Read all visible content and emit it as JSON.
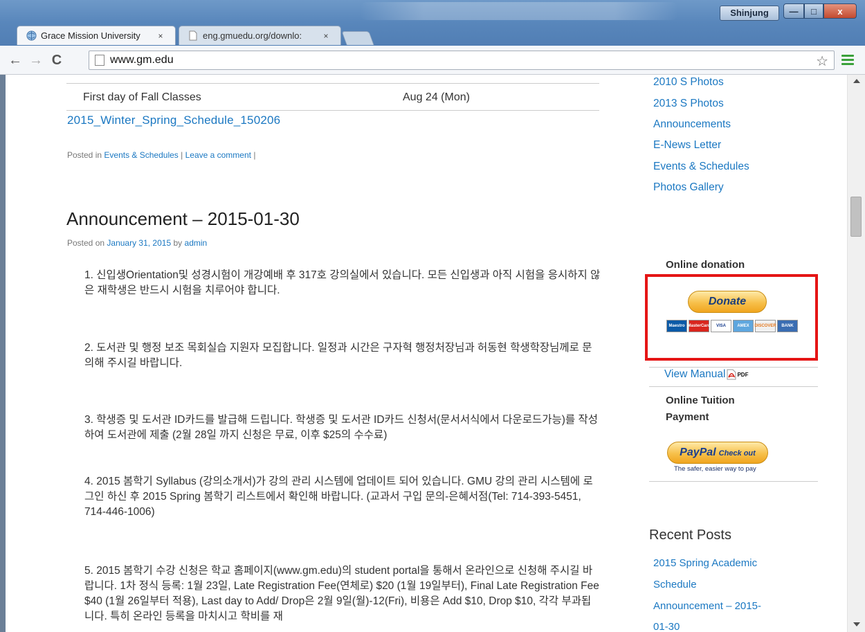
{
  "window": {
    "user": "Shinjung",
    "min_glyph": "—",
    "max_glyph": "□",
    "close_glyph": "x"
  },
  "tabs": [
    {
      "title": "Grace Mission University",
      "close": "×",
      "active": true
    },
    {
      "title": "eng.gmuedu.org/downlo:",
      "close": "×",
      "active": false
    }
  ],
  "toolbar": {
    "back": "←",
    "forward": "→",
    "reload": "C",
    "url": "www.gm.edu",
    "star": "☆"
  },
  "schedule": {
    "event": "First day of Fall Classes",
    "date": "Aug 24 (Mon)",
    "file_link": "2015_Winter_Spring_Schedule_150206"
  },
  "prev_post": {
    "posted_in": "Posted in",
    "category": "Events & Schedules",
    "sep1": " | ",
    "comment": "Leave a comment",
    "sep2": " |"
  },
  "post": {
    "title": "Announcement – 2015-01-30",
    "posted_on": "Posted on",
    "date": "January 31, 2015",
    "by": "by",
    "author": "admin",
    "paragraphs": [
      "1. 신입생Orientation및 성경시험이 개강예배 후 317호 강의실에서 있습니다. 모든 신입생과 아직 시험을 응시하지 않은 재학생은 반드시 시험을 치루어야 합니다.",
      "2. 도서관 및 행정 보조 목회실습 지원자 모집합니다. 일정과 시간은 구자혁 행정처장님과 허동현 학생학장님께로 문의해 주시길 바랍니다.",
      "3. 학생증 및 도서관 ID카드를 발급해 드립니다. 학생증 및 도서관 ID카드 신청서(문서서식에서 다운로드가능)를 작성하여 도서관에 제출 (2월 28일 까지 신청은 무료, 이후 $25의 수수료)",
      "4. 2015 봄학기 Syllabus (강의소개서)가 강의 관리 시스템에 업데이트 되어 있습니다. GMU 강의 관리 시스템에 로그인 하신 후 2015 Spring 봄학기 리스트에서 확인해 바랍니다. (교과서 구입 문의-은혜서점(Tel: 714-393-5451, 714-446-1006)",
      "5. 2015 봄학기 수강 신청은 학교 홈페이지(www.gm.edu)의 student portal을 통해서 온라인으로 신청해 주시길 바랍니다. 1차 정식 등록: 1월 23일, Late Registration Fee(연체로) $20 (1월 19일부터), Final Late Registration Fee $40 (1월 26일부터 적용), Last day to Add/ Drop은 2월 9일(월)-12(Fri), 비용은 Add $10, Drop $10, 각각 부과됩니다. 특히 온라인 등록을 마치시고 학비를 재"
    ]
  },
  "sidebar": {
    "categories": [
      "2010 S Photos",
      "2013 S Photos",
      "Announcements",
      "E-News Letter",
      "Events & Schedules",
      "Photos Gallery"
    ],
    "donation_heading": "Online donation",
    "donate_label": "Donate",
    "cards": [
      "Maestro",
      "MasterCard",
      "VISA",
      "AMEX",
      "DISCOVER",
      "BANK"
    ],
    "view_manual": "View Manual",
    "pdf_label": "PDF",
    "tuition_heading_1": "Online Tuition",
    "tuition_heading_2": "Payment",
    "paypal_brand": "PayPal",
    "paypal_action": "Check out",
    "paypal_tagline": "The safer, easier way to pay",
    "recent_heading": "Recent Posts",
    "recent_posts": [
      "2015 Spring Academic",
      "Schedule",
      "Announcement – 2015-",
      "01-30"
    ]
  }
}
